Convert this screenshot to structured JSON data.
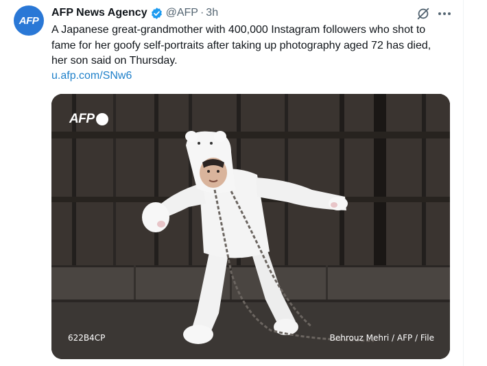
{
  "tweet": {
    "author_name": "AFP News Agency",
    "author_handle": "@AFP",
    "separator": "·",
    "timestamp": "3h",
    "avatar_text": "AFP",
    "verified_icon": "verified-badge-icon",
    "text": "A Japanese great-grandmother with 400,000 Instagram followers who shot to fame for her goofy self-portraits after taking up photography aged 72 has died, her son said on Thursday.",
    "link": "u.afp.com/SNw6",
    "colors": {
      "link": "#1d7fc9",
      "avatar_bg": "#2a78d6",
      "verified": "#1d9bf0",
      "secondary_text": "#536471"
    }
  },
  "actions": {
    "grok_icon": "grok-icon",
    "more_icon": "more-icon"
  },
  "media": {
    "watermark_logo": "AFP",
    "image_code": "622B4CP",
    "credit": "Behrouz Mehri / AFP / File"
  }
}
